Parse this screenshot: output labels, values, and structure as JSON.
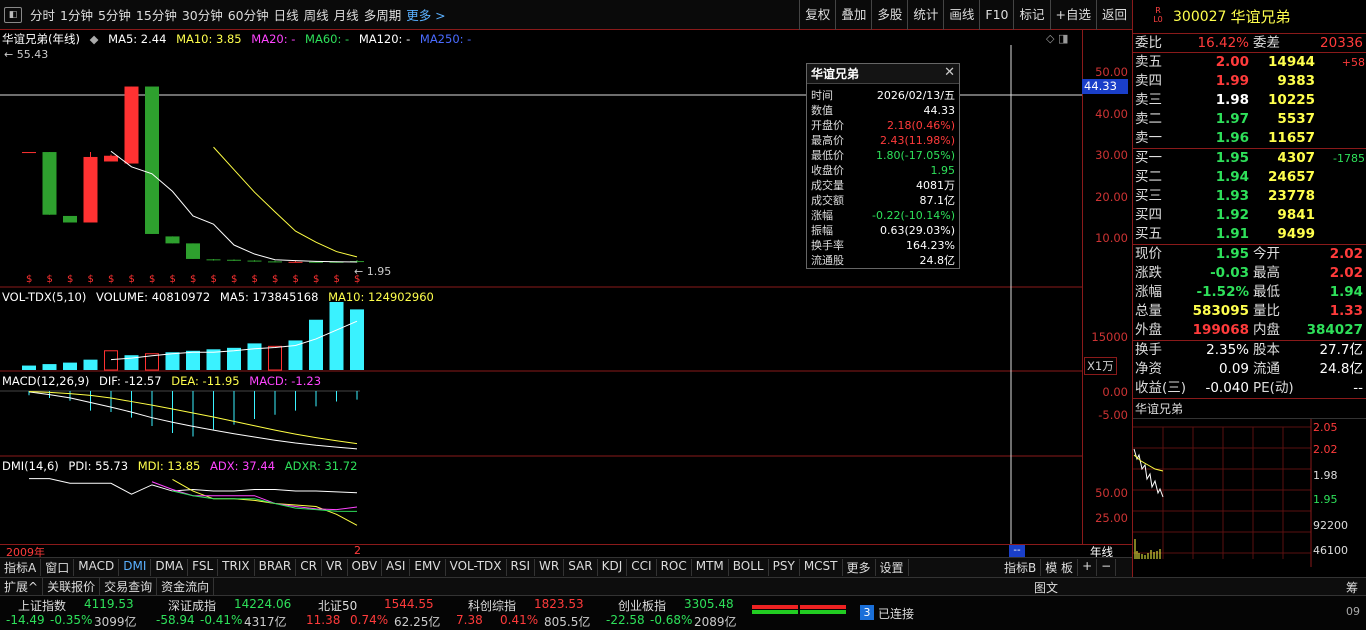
{
  "toolbar": {
    "periods": [
      "分时",
      "1分钟",
      "5分钟",
      "15分钟",
      "30分钟",
      "60分钟",
      "日线",
      "周线",
      "月线",
      "多周期"
    ],
    "more": "更多 >",
    "right_buttons": [
      "复权",
      "叠加",
      "多股",
      "统计",
      "画线",
      "F10",
      "标记",
      "+自选",
      "返回"
    ]
  },
  "main": {
    "title": "华谊兄弟(年线)",
    "ma5": "MA5: 2.44",
    "ma10": "MA10: 3.85",
    "ma20": "MA20: -",
    "ma60": "MA60: -",
    "ma120": "MA120: -",
    "ma250": "MA250: -",
    "max_label": "55.43",
    "last_label": "1.95",
    "price_axis": [
      "50.00",
      "40.00",
      "30.00",
      "20.00",
      "10.00"
    ],
    "crosshair_price": "44.33"
  },
  "vol": {
    "name": "VOL-TDX(5,10)",
    "volume": "VOLUME: 40810972",
    "ma5": "MA5: 173845168",
    "ma10": "MA10: 124902960",
    "axis": "15000",
    "unit": "X1万"
  },
  "macd": {
    "name": "MACD(12,26,9)",
    "dif": "DIF: -12.57",
    "dea": "DEA: -11.95",
    "macd": "MACD: -1.23",
    "axis": [
      "0.00",
      "-5.00"
    ]
  },
  "dmi": {
    "name": "DMI(14,6)",
    "pdi": "PDI: 55.73",
    "mdi": "MDI: 13.85",
    "adx": "ADX: 37.44",
    "adxr": "ADXR: 31.72",
    "axis": [
      "50.00",
      "25.00"
    ]
  },
  "xaxis": {
    "start": "2009年",
    "end": "2",
    "period_label": "年线",
    "cursor_label": "--"
  },
  "popup": {
    "title": "华谊兄弟",
    "rows": [
      {
        "k": "时间",
        "v": "2026/02/13/五",
        "c": "white"
      },
      {
        "k": "数值",
        "v": "44.33",
        "c": "white"
      },
      {
        "k": "开盘价",
        "v": "2.18(0.46%)",
        "c": "red"
      },
      {
        "k": "最高价",
        "v": "2.43(11.98%)",
        "c": "red"
      },
      {
        "k": "最低价",
        "v": "1.80(-17.05%)",
        "c": "green"
      },
      {
        "k": "收盘价",
        "v": "1.95",
        "c": "green"
      },
      {
        "k": "成交量",
        "v": "4081万",
        "c": "white"
      },
      {
        "k": "成交额",
        "v": "87.1亿",
        "c": "white"
      },
      {
        "k": "涨幅",
        "v": "-0.22(-10.14%)",
        "c": "green"
      },
      {
        "k": "振幅",
        "v": "0.63(29.03%)",
        "c": "white"
      },
      {
        "k": "换手率",
        "v": "164.23%",
        "c": "white"
      },
      {
        "k": "流通股",
        "v": "24.8亿",
        "c": "white"
      }
    ]
  },
  "quote": {
    "badge": "R\nL0",
    "code": "300027",
    "name": "华谊兄弟",
    "weibi_label": "委比",
    "weibi": "16.42%",
    "weicha_label": "委差",
    "weicha": "20336",
    "asks": [
      {
        "label": "卖五",
        "price": "2.00",
        "vol": "14944",
        "chg": "+58",
        "pc": "red"
      },
      {
        "label": "卖四",
        "price": "1.99",
        "vol": "9383",
        "chg": "",
        "pc": "red"
      },
      {
        "label": "卖三",
        "price": "1.98",
        "vol": "10225",
        "chg": "",
        "pc": "white"
      },
      {
        "label": "卖二",
        "price": "1.97",
        "vol": "5537",
        "chg": "",
        "pc": "green"
      },
      {
        "label": "卖一",
        "price": "1.96",
        "vol": "11657",
        "chg": "",
        "pc": "green"
      }
    ],
    "bids": [
      {
        "label": "买一",
        "price": "1.95",
        "vol": "4307",
        "chg": "-1785",
        "pc": "green"
      },
      {
        "label": "买二",
        "price": "1.94",
        "vol": "24657",
        "chg": "",
        "pc": "green"
      },
      {
        "label": "买三",
        "price": "1.93",
        "vol": "23778",
        "chg": "",
        "pc": "green"
      },
      {
        "label": "买四",
        "price": "1.92",
        "vol": "9841",
        "chg": "",
        "pc": "green"
      },
      {
        "label": "买五",
        "price": "1.91",
        "vol": "9499",
        "chg": "",
        "pc": "green"
      }
    ],
    "stats": [
      {
        "l1": "现价",
        "v1": "1.95",
        "c1": "green",
        "l2": "今开",
        "v2": "2.02",
        "c2": "red"
      },
      {
        "l1": "涨跌",
        "v1": "-0.03",
        "c1": "green",
        "l2": "最高",
        "v2": "2.02",
        "c2": "red"
      },
      {
        "l1": "涨幅",
        "v1": "-1.52%",
        "c1": "green",
        "l2": "最低",
        "v2": "1.94",
        "c2": "green"
      },
      {
        "l1": "总量",
        "v1": "583095",
        "c1": "yel",
        "l2": "量比",
        "v2": "1.33",
        "c2": "red"
      },
      {
        "l1": "外盘",
        "v1": "199068",
        "c1": "red",
        "l2": "内盘",
        "v2": "384027",
        "c2": "green"
      }
    ],
    "fund": [
      {
        "l1": "换手",
        "v1": "2.35%",
        "l2": "股本",
        "v2": "27.7亿"
      },
      {
        "l1": "净资",
        "v1": "0.09",
        "l2": "流通",
        "v2": "24.8亿"
      },
      {
        "l1": "收益(三)",
        "v1": "-0.040",
        "l2": "PE(动)",
        "v2": "--"
      }
    ],
    "mini_title": "华谊兄弟",
    "mini_axis": [
      "2.05",
      "2.02",
      "1.98",
      "1.95",
      "92200",
      "46100"
    ]
  },
  "bottom_tabs": [
    "指标A",
    "窗口",
    "MACD",
    "DMI",
    "DMA",
    "FSL",
    "TRIX",
    "BRAR",
    "CR",
    "VR",
    "OBV",
    "ASI",
    "EMV",
    "VOL-TDX",
    "RSI",
    "WR",
    "SAR",
    "KDJ",
    "CCI",
    "ROC",
    "MTM",
    "BOLL",
    "PSY",
    "MCST",
    "更多",
    "设置"
  ],
  "bottom_right": [
    "指标B",
    "模 板",
    "+",
    "−"
  ],
  "bar2": [
    "扩展^",
    "关联报价",
    "交易查询",
    "资金流向"
  ],
  "bar2_right": [
    "图文",
    "筹"
  ],
  "indices": [
    {
      "name": "上证指数",
      "val": "4119.53",
      "chg": "-14.49",
      "pct": "-0.35%",
      "amt": "3099亿",
      "vc": "green",
      "cc": "green"
    },
    {
      "name": "深证成指",
      "val": "14224.06",
      "chg": "-58.94",
      "pct": "-0.41%",
      "amt": "4317亿",
      "vc": "green",
      "cc": "green"
    },
    {
      "name": "北证50",
      "val": "1544.55",
      "chg": "11.38",
      "pct": "0.74%",
      "amt": "62.25亿",
      "vc": "red",
      "cc": "red"
    },
    {
      "name": "科创综指",
      "val": "1823.53",
      "chg": "7.38",
      "pct": "0.41%",
      "amt": "805.5亿",
      "vc": "red",
      "cc": "red"
    },
    {
      "name": "创业板指",
      "val": "3305.48",
      "chg": "-22.58",
      "pct": "-0.68%",
      "amt": "2089亿",
      "vc": "green",
      "cc": "green"
    }
  ],
  "status": {
    "num": "3",
    "text": "已连接",
    "time": "09"
  },
  "chart_data": {
    "type": "candlestick",
    "candles": [
      {
        "o": 28.8,
        "h": 28.8,
        "c": 28.8,
        "l": 28.8
      },
      {
        "o": 28.8,
        "h": 28.8,
        "l": 13.5,
        "c": 13.5
      },
      {
        "o": 13.2,
        "h": 13.2,
        "l": 11.6,
        "c": 11.6
      },
      {
        "o": 11.6,
        "h": 28.8,
        "l": 11.6,
        "c": 27.6
      },
      {
        "o": 26.5,
        "h": 28.2,
        "l": 26.5,
        "c": 27.9
      },
      {
        "o": 26.0,
        "h": 44.8,
        "l": 26.0,
        "c": 44.8
      },
      {
        "o": 44.8,
        "h": 44.8,
        "l": 8.8,
        "c": 8.8
      },
      {
        "o": 8.2,
        "h": 8.2,
        "l": 6.5,
        "c": 6.5
      },
      {
        "o": 6.5,
        "h": 6.5,
        "l": 2.7,
        "c": 2.7
      },
      {
        "o": 2.6,
        "h": 2.7,
        "l": 2.3,
        "c": 2.5
      },
      {
        "o": 2.5,
        "h": 2.6,
        "l": 2.2,
        "c": 2.3
      },
      {
        "o": 2.3,
        "h": 2.4,
        "l": 2.0,
        "c": 2.1
      },
      {
        "o": 2.1,
        "h": 2.3,
        "l": 1.9,
        "c": 2.0
      },
      {
        "o": 2.0,
        "h": 2.2,
        "l": 1.9,
        "c": 2.0
      },
      {
        "o": 2.0,
        "h": 2.1,
        "l": 1.8,
        "c": 1.9
      },
      {
        "o": 2.0,
        "h": 2.1,
        "l": 1.8,
        "c": 1.9
      },
      {
        "o": 2.18,
        "h": 2.43,
        "l": 1.8,
        "c": 1.95
      }
    ],
    "ma5": [
      null,
      null,
      null,
      null,
      29.0,
      25.2,
      23.5,
      19.2,
      13.2,
      11.2,
      6.1,
      3.9,
      2.5,
      2.3,
      2.1,
      2.0,
      1.95
    ],
    "ma10": [
      null,
      null,
      null,
      null,
      null,
      null,
      null,
      null,
      null,
      30.0,
      24.5,
      19.0,
      14.2,
      9.5,
      6.8,
      4.5,
      3.2
    ],
    "volume": [
      1.5,
      2.0,
      2.5,
      3.5,
      6.5,
      5.0,
      5.5,
      6.0,
      6.5,
      7.0,
      7.5,
      9.0,
      8.0,
      10.0,
      17.0,
      23.0,
      20.5
    ],
    "vol_up": [
      false,
      false,
      false,
      false,
      true,
      false,
      true,
      false,
      false,
      false,
      false,
      false,
      true,
      false,
      false,
      false,
      false
    ],
    "vol_ma5": [
      null,
      null,
      null,
      null,
      3.5,
      4.0,
      4.8,
      5.5,
      6.0,
      6.0,
      6.5,
      7.2,
      7.6,
      8.3,
      10.5,
      13.5,
      16.5
    ],
    "macd_dif": [
      -0.2,
      -0.8,
      -1.5,
      -2.5,
      -3.5,
      -4.6,
      -5.8,
      -6.8,
      -7.7,
      -8.5,
      -9.3,
      -10.0,
      -10.7,
      -11.3,
      -11.8,
      -12.2,
      -12.57
    ],
    "macd_dea": [
      -0.1,
      -0.3,
      -0.6,
      -1.0,
      -1.6,
      -2.4,
      -3.2,
      -4.1,
      -5.0,
      -5.9,
      -6.9,
      -7.9,
      -8.9,
      -9.8,
      -10.6,
      -11.3,
      -11.95
    ],
    "macd_hist": [
      -0.6,
      -1.0,
      -1.4,
      -2.8,
      -3.0,
      -3.8,
      -5.0,
      -6.0,
      -6.5,
      -5.5,
      -4.8,
      -4.0,
      -3.4,
      -2.8,
      -2.2,
      -1.5,
      -1.23
    ],
    "pdi": [
      74,
      74,
      68,
      68,
      68,
      54,
      66,
      58,
      60,
      58,
      58,
      60,
      60,
      58,
      58,
      57,
      55.73
    ],
    "mdi": [
      null,
      null,
      null,
      null,
      null,
      null,
      null,
      73,
      58,
      48,
      48,
      46,
      42,
      40,
      38,
      28,
      13.85
    ],
    "adx": [
      null,
      null,
      null,
      null,
      null,
      null,
      70,
      60,
      52,
      52,
      52,
      52,
      42,
      38,
      35,
      34,
      37.44
    ],
    "adxr": [
      null,
      null,
      null,
      null,
      null,
      null,
      null,
      58,
      52,
      48,
      48,
      48,
      42,
      36,
      34,
      32,
      31.72
    ],
    "ylim": [
      0,
      55.43
    ]
  }
}
